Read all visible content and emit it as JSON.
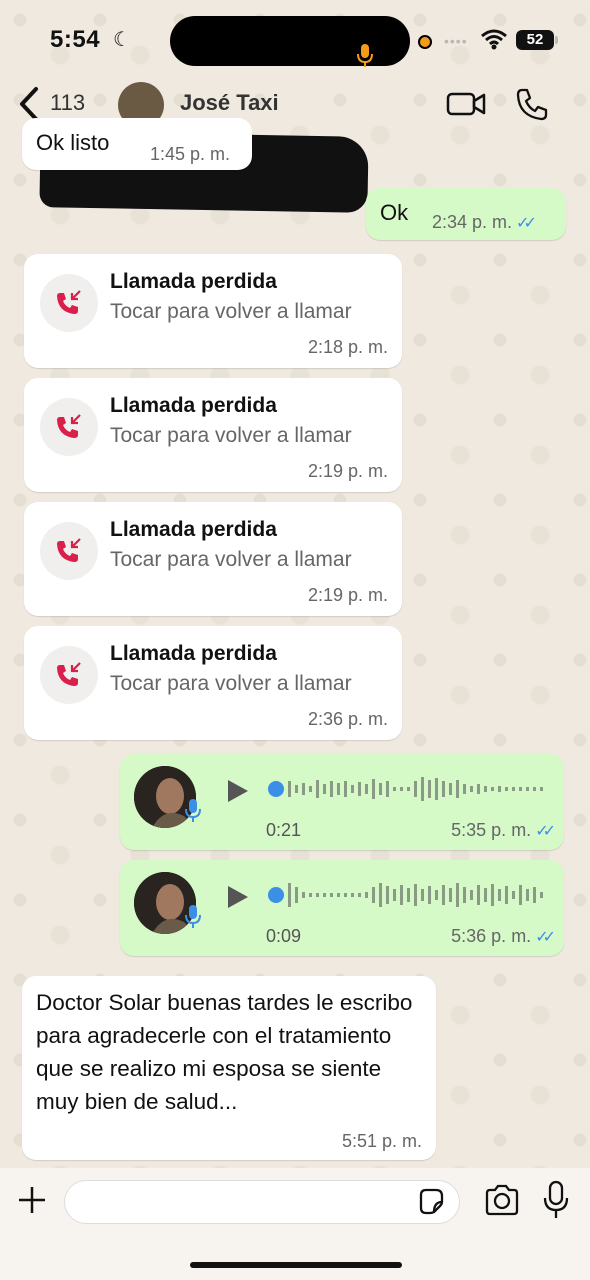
{
  "status_bar": {
    "time": "5:54",
    "battery": "52"
  },
  "header": {
    "unread_count": "113",
    "contact_name": "José Taxi"
  },
  "messages": {
    "m0": {
      "text": "Ok listo",
      "time": "1:45 p. m."
    },
    "m1": {
      "text": "Ok",
      "time": "2:34 p. m."
    },
    "calls": [
      {
        "title": "Llamada perdida",
        "subtitle": "Tocar para volver a llamar",
        "time": "2:18 p. m."
      },
      {
        "title": "Llamada perdida",
        "subtitle": "Tocar para volver a llamar",
        "time": "2:19 p. m."
      },
      {
        "title": "Llamada perdida",
        "subtitle": "Tocar para volver a llamar",
        "time": "2:19 p. m."
      },
      {
        "title": "Llamada perdida",
        "subtitle": "Tocar para volver a llamar",
        "time": "2:36 p. m."
      }
    ],
    "voice": [
      {
        "duration": "0:21",
        "time": "5:35 p. m."
      },
      {
        "duration": "0:09",
        "time": "5:36 p. m."
      }
    ],
    "m_last": {
      "text": "Doctor Solar  buenas tardes le escribo para agradecerle con el tratamiento que se realizo mi esposa se siente muy bien de salud...",
      "time": "5:51 p. m."
    }
  },
  "composer": {
    "placeholder": ""
  },
  "colors": {
    "outgoing": "#d6f9c8",
    "incoming": "#ffffff",
    "missed_call": "#d8204a",
    "read_ticks": "#3b8fe6"
  }
}
